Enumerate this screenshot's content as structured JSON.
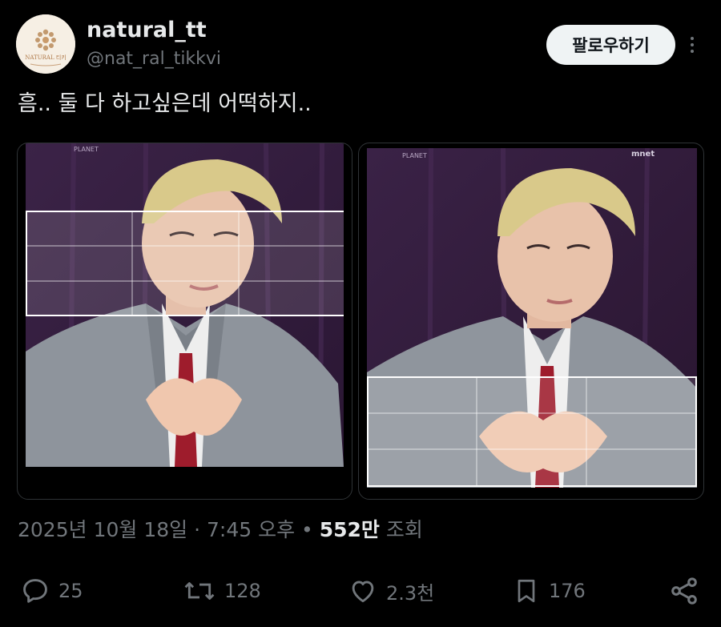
{
  "author": {
    "display_name": "natural_tt",
    "handle": "@nat_ral_tikkvi",
    "avatar_text": "NATURAL 티키"
  },
  "follow_label": "팔로우하기",
  "tweet_text": "흠.. 둘 다 하고싶은데 어떡하지..",
  "media": [
    {
      "watermark": "PLANET C",
      "crop_box": "eyes band"
    },
    {
      "watermark": "PLANET C",
      "channel_logo": "mnet",
      "crop_box": "hands band"
    }
  ],
  "meta": {
    "date": "2025년 10월 18일",
    "separator": "·",
    "time": "7:45 오후",
    "bullet": "•",
    "views_count": "552만",
    "views_label": "조회"
  },
  "actions": {
    "replies": "25",
    "retweets": "128",
    "likes": "2.3천",
    "bookmarks": "176"
  },
  "colors": {
    "background": "#000000",
    "primary_text": "#e7e9ea",
    "secondary_text": "#71767b",
    "follow_bg": "#eff3f4",
    "border": "#2f3336"
  }
}
